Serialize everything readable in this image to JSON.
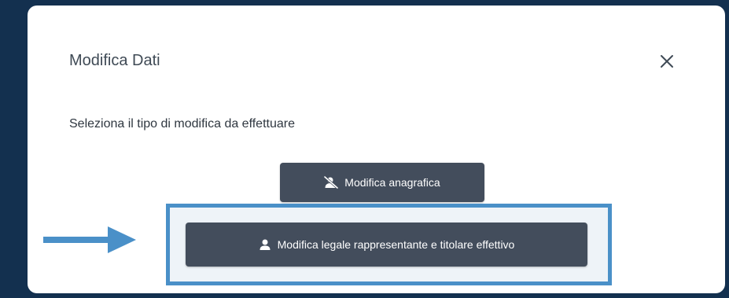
{
  "modal": {
    "title": "Modifica Dati",
    "close_icon": "close-icon",
    "subtitle": "Seleziona il tipo di modifica da effettuare",
    "buttons": {
      "anagrafica": {
        "label": "Modifica anagrafica",
        "icon": "user-slash-icon"
      },
      "legale": {
        "label": "Modifica legale rappresentante e titolare effettivo",
        "icon": "user-icon"
      }
    }
  },
  "annotation": {
    "highlight_color": "#4a90c8",
    "arrow_icon": "arrow-right-icon"
  },
  "colors": {
    "background": "#13304f",
    "button": "#434d5c"
  }
}
